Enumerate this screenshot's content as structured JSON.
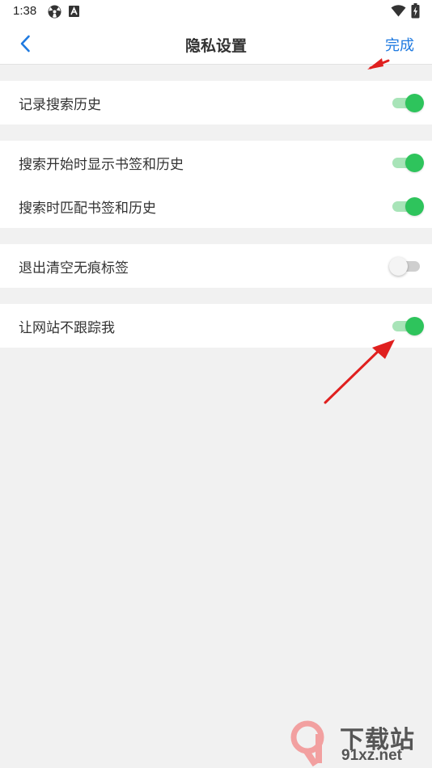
{
  "status_bar": {
    "time": "1:38",
    "icons": [
      "radiation-icon",
      "a-badge-icon",
      "wifi-icon",
      "battery-icon"
    ]
  },
  "header": {
    "title": "隐私设置",
    "back_icon": "chevron-left-icon",
    "done_label": "完成"
  },
  "colors": {
    "accent": "#1f7ae0",
    "toggle_on": "#2ec45c",
    "toggle_on_track": "#a8e4b8",
    "toggle_off_track": "#cfcfcf",
    "background": "#f1f1f1",
    "annotation_arrow": "#e0201f"
  },
  "settings": {
    "group1": [
      {
        "label": "记录搜索历史",
        "enabled": true
      }
    ],
    "group2": [
      {
        "label": "搜索开始时显示书签和历史",
        "enabled": true
      },
      {
        "label": "搜索时匹配书签和历史",
        "enabled": true
      }
    ],
    "group3": [
      {
        "label": "退出清空无痕标签",
        "enabled": false
      }
    ],
    "group4": [
      {
        "label": "让网站不跟踪我",
        "enabled": true
      }
    ]
  },
  "watermark": {
    "logo_text": "91",
    "site_name": "下载站",
    "domain": "91xz.net"
  }
}
